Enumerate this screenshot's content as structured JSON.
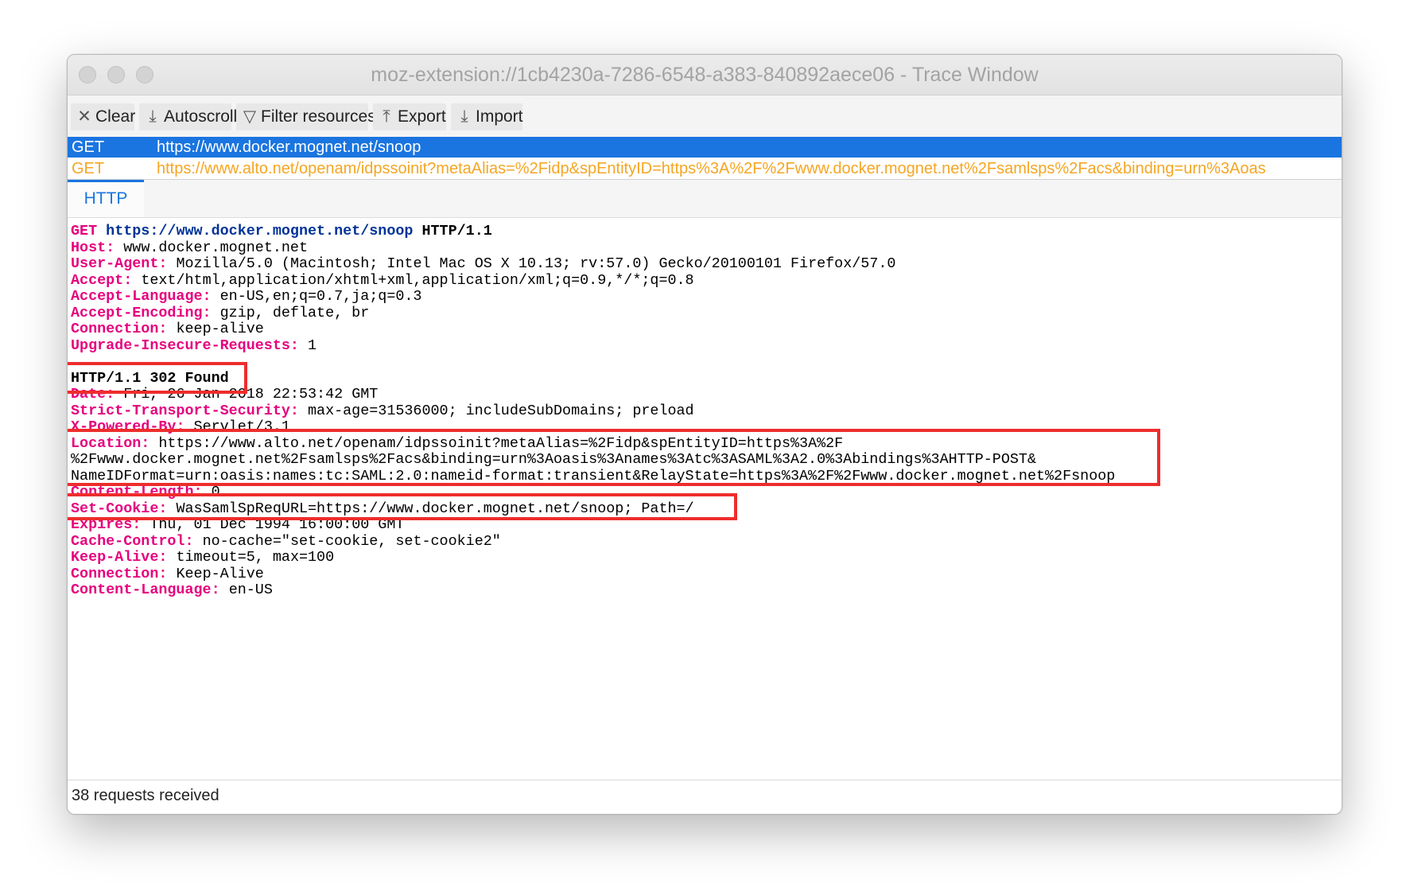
{
  "window": {
    "title": "moz-extension://1cb4230a-7286-6548-a383-840892aece06 - Trace Window"
  },
  "toolbar": {
    "clear": {
      "icon": "close-icon",
      "glyph": "✕",
      "label": "Clear"
    },
    "autoscroll": {
      "icon": "download-icon",
      "glyph": "⤓",
      "label": "Autoscroll"
    },
    "filter": {
      "icon": "filter-icon",
      "glyph": "▽",
      "label": "Filter resources"
    },
    "export": {
      "icon": "upload-icon",
      "glyph": "⤒",
      "label": "Export"
    },
    "import": {
      "icon": "download-icon",
      "glyph": "⤓",
      "label": "Import"
    }
  },
  "requests": [
    {
      "method": "GET",
      "url": "https://www.docker.mognet.net/snoop",
      "selected": true
    },
    {
      "method": "GET",
      "url": "https://www.alto.net/openam/idpssoinit?metaAlias=%2Fidp&spEntityID=https%3A%2F%2Fwww.docker.mognet.net%2Fsamlsps%2Facs&binding=urn%3Aoas",
      "selected": false
    }
  ],
  "tabs": [
    {
      "label": "HTTP",
      "active": true
    }
  ],
  "request_line": {
    "method": "GET",
    "url": "https://www.docker.mognet.net/snoop",
    "version": "HTTP/1.1"
  },
  "request_headers": [
    {
      "key": "Host",
      "value": "www.docker.mognet.net"
    },
    {
      "key": "User-Agent",
      "value": "Mozilla/5.0 (Macintosh; Intel Mac OS X 10.13; rv:57.0) Gecko/20100101 Firefox/57.0"
    },
    {
      "key": "Accept",
      "value": "text/html,application/xhtml+xml,application/xml;q=0.9,*/*;q=0.8"
    },
    {
      "key": "Accept-Language",
      "value": "en-US,en;q=0.7,ja;q=0.3"
    },
    {
      "key": "Accept-Encoding",
      "value": "gzip, deflate, br"
    },
    {
      "key": "Connection",
      "value": "keep-alive"
    },
    {
      "key": "Upgrade-Insecure-Requests",
      "value": "1"
    }
  ],
  "response_status": "HTTP/1.1 302 Found",
  "response_headers": {
    "date": {
      "key": "Date",
      "value": "Fri, 26 Jan 2018 22:53:42 GMT"
    },
    "sts": {
      "key": "Strict-Transport-Security",
      "value": "max-age=31536000; includeSubDomains; preload"
    },
    "powered": {
      "key": "X-Powered-By",
      "value": "Servlet/3.1"
    },
    "location": {
      "key": "Location",
      "value_line1": "https://www.alto.net/openam/idpssoinit?metaAlias=%2Fidp&spEntityID=https%3A%2F",
      "value_line2": "%2Fwww.docker.mognet.net%2Fsamlsps%2Facs&binding=urn%3Aoasis%3Anames%3Atc%3ASAML%3A2.0%3Abindings%3AHTTP-POST&",
      "value_line3": "NameIDFormat=urn:oasis:names:tc:SAML:2.0:nameid-format:transient&RelayState=https%3A%2F%2Fwww.docker.mognet.net%2Fsnoop"
    },
    "content_length": {
      "key": "Content-Length",
      "value": "0"
    },
    "set_cookie": {
      "key": "Set-Cookie",
      "value": "WasSamlSpReqURL=https://www.docker.mognet.net/snoop; Path=/"
    },
    "expires": {
      "key": "Expires",
      "value": "Thu, 01 Dec 1994 16:00:00 GMT"
    },
    "cache_control": {
      "key": "Cache-Control",
      "value": "no-cache=\"set-cookie, set-cookie2\""
    },
    "keep_alive": {
      "key": "Keep-Alive",
      "value": "timeout=5, max=100"
    },
    "connection": {
      "key": "Connection",
      "value": "Keep-Alive"
    },
    "content_language": {
      "key": "Content-Language",
      "value": "en-US"
    }
  },
  "status_bar": {
    "text": "38 requests received"
  },
  "colors": {
    "header_key": "#e6007e",
    "request_url": "#003399",
    "selected_row": "#1a75e0",
    "other_row_text": "#f5a623",
    "annotation_box": "#ee2d2d"
  }
}
